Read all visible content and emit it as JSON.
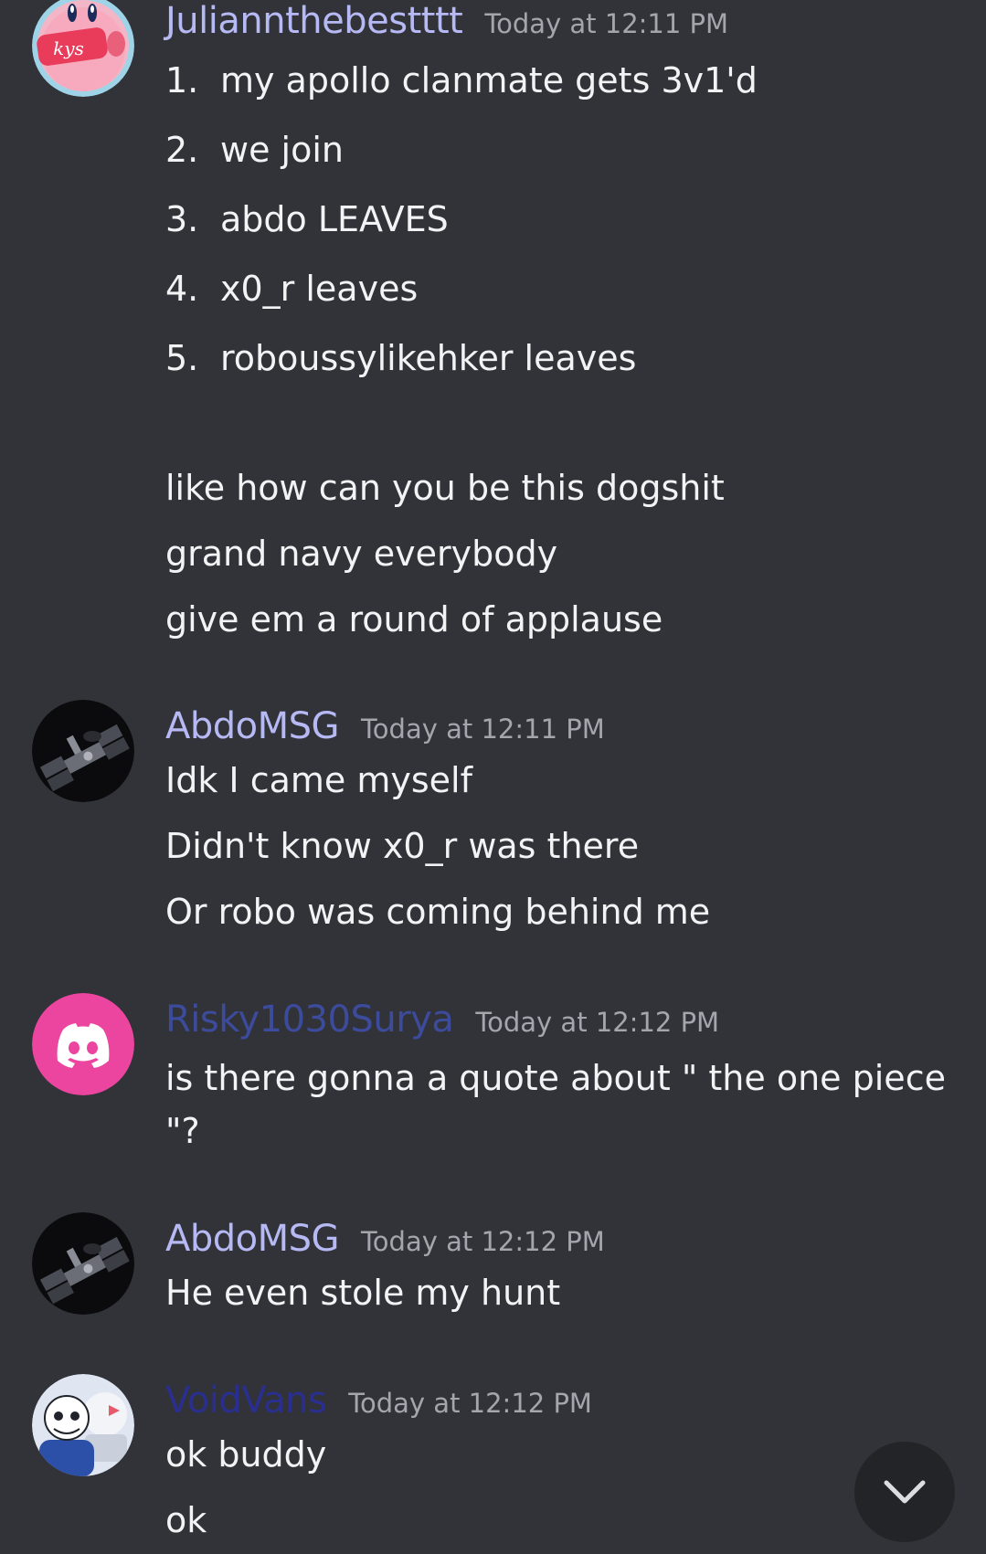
{
  "messages": [
    {
      "username": "Juliannthebestttt",
      "username_color": "#b7b9f5",
      "timestamp": "Today at 12:11 PM",
      "avatar_icon": "kirby-kys-avatar",
      "avatar_text": "kys",
      "list": [
        {
          "num": "1.",
          "text": "my apollo clanmate gets 3v1'd"
        },
        {
          "num": "2.",
          "text": "we join"
        },
        {
          "num": "3.",
          "text": "abdo LEAVES"
        },
        {
          "num": "4.",
          "text": "x0_r leaves"
        },
        {
          "num": "5.",
          "text": "roboussylikehker leaves"
        }
      ],
      "lines": [
        "like how can you be this dogshit",
        "grand navy everybody",
        "give em a round of applause"
      ]
    },
    {
      "username": "AbdoMSG",
      "username_color": "#b7b9f5",
      "timestamp": "Today at 12:11 PM",
      "avatar_icon": "space-station-avatar",
      "lines": [
        "Idk I came myself",
        "Didn't know x0_r was there",
        "Or robo was coming behind me"
      ]
    },
    {
      "username": "Risky1030Surya",
      "username_color": "#3c4b9b",
      "timestamp": "Today at 12:12 PM",
      "avatar_icon": "discord-default-avatar",
      "lines": [
        "is there gonna a quote about \" the one piece \"?"
      ]
    },
    {
      "username": "AbdoMSG",
      "username_color": "#b7b9f5",
      "timestamp": "Today at 12:12 PM",
      "avatar_icon": "space-station-avatar",
      "lines": [
        "He even stole my hunt"
      ]
    },
    {
      "username": "VoidVans",
      "username_color": "#2a2f8f",
      "timestamp": "Today at 12:12 PM",
      "avatar_icon": "sans-papyrus-avatar",
      "lines": [
        "ok buddy",
        "ok"
      ]
    }
  ],
  "scroll_button": {
    "icon": "chevron-down-icon"
  }
}
